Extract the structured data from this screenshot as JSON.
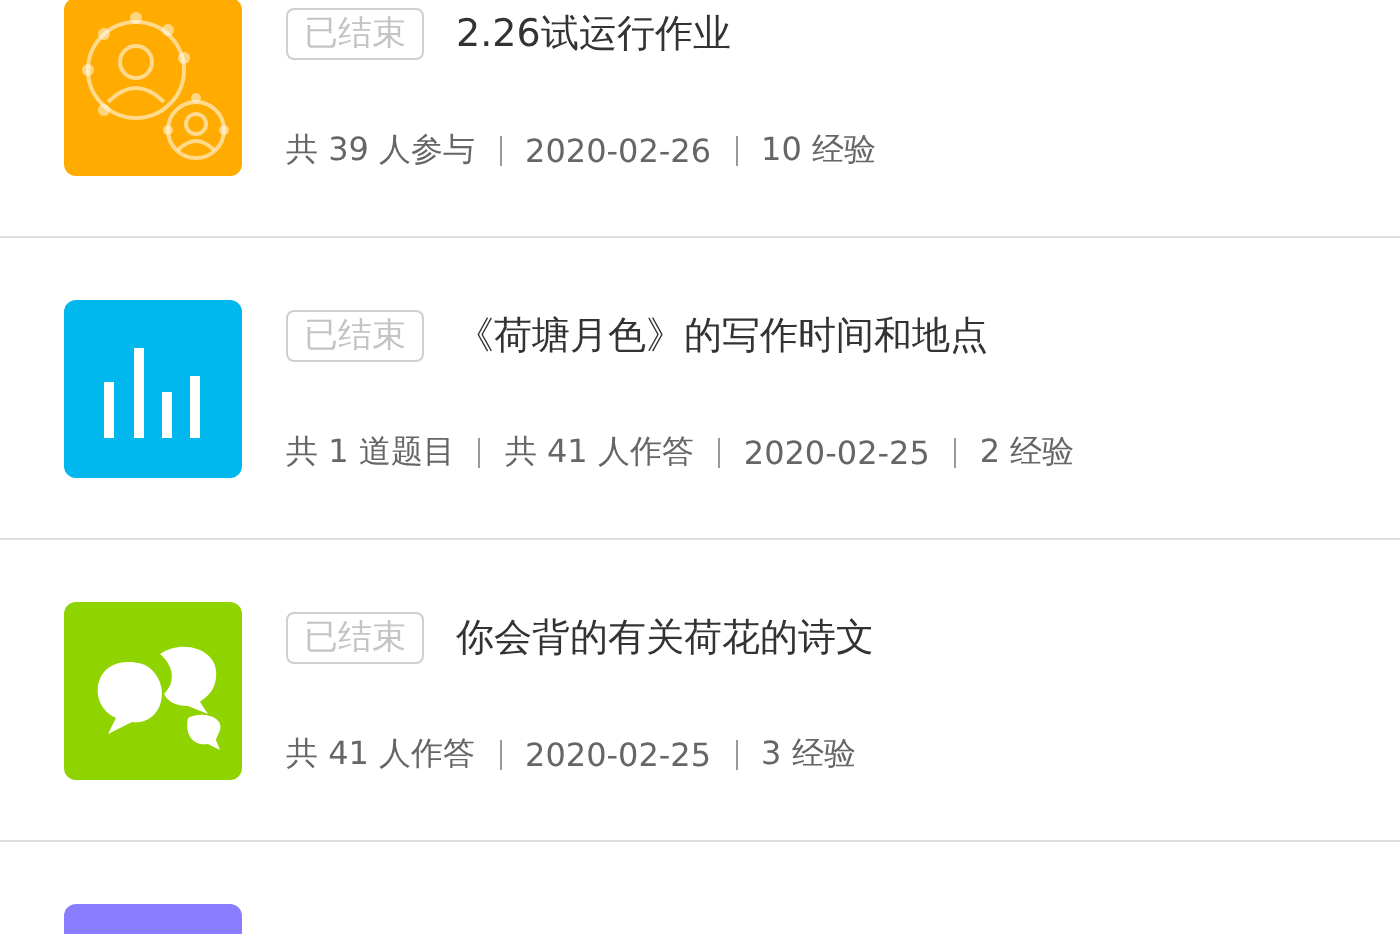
{
  "activities": [
    {
      "kind": "survey",
      "color": "#ffab00",
      "status": "已结束",
      "title": "2.26试运行作业",
      "meta": [
        "共 39 人参与",
        "2020-02-26",
        "10 经验"
      ]
    },
    {
      "kind": "quiz",
      "color": "#00b8ee",
      "status": "已结束",
      "title": "《荷塘月色》的写作时间和地点",
      "meta": [
        "共 1 道题目",
        "共 41 人作答",
        "2020-02-25",
        "2 经验"
      ]
    },
    {
      "kind": "discussion",
      "color": "#8fd400",
      "status": "已结束",
      "title": "你会背的有关荷花的诗文",
      "meta": [
        "共 41 人作答",
        "2020-02-25",
        "3 经验"
      ]
    },
    {
      "kind": "other",
      "color": "#8a7cff"
    }
  ]
}
